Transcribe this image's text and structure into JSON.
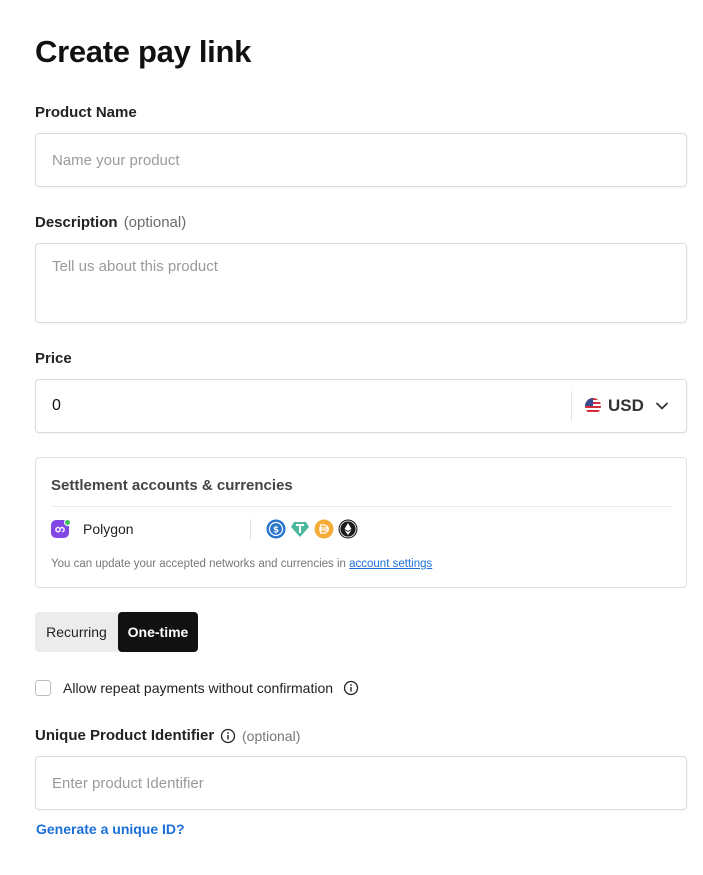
{
  "page": {
    "title": "Create pay link"
  },
  "product_name": {
    "label": "Product Name",
    "placeholder": "Name your product",
    "value": ""
  },
  "description": {
    "label": "Description",
    "optional": "(optional)",
    "placeholder": "Tell us about this product",
    "value": ""
  },
  "price": {
    "label": "Price",
    "value": "0",
    "currency": "USD",
    "flag_icon": "us-flag-icon"
  },
  "settlement": {
    "title": "Settlement accounts & currencies",
    "network": "Polygon",
    "network_icon": "polygon-icon",
    "coins": [
      "usdc-icon",
      "usdt-icon",
      "dai-icon",
      "ethereum-icon"
    ],
    "note_prefix": "You can update your accepted networks and currencies in ",
    "note_link": "account settings"
  },
  "payment_type": {
    "options": [
      "Recurring",
      "One-time"
    ],
    "selected": "One-time"
  },
  "repeat_payments": {
    "label": "Allow repeat payments without confirmation",
    "checked": false
  },
  "unique_id": {
    "label": "Unique Product Identifier",
    "optional": "(optional)",
    "placeholder": "Enter product Identifier",
    "generate_link": "Generate a unique ID?"
  },
  "colors": {
    "accent_link": "#1a6fd8",
    "selected_segment": "#111111",
    "polygon": "#8247e5"
  }
}
